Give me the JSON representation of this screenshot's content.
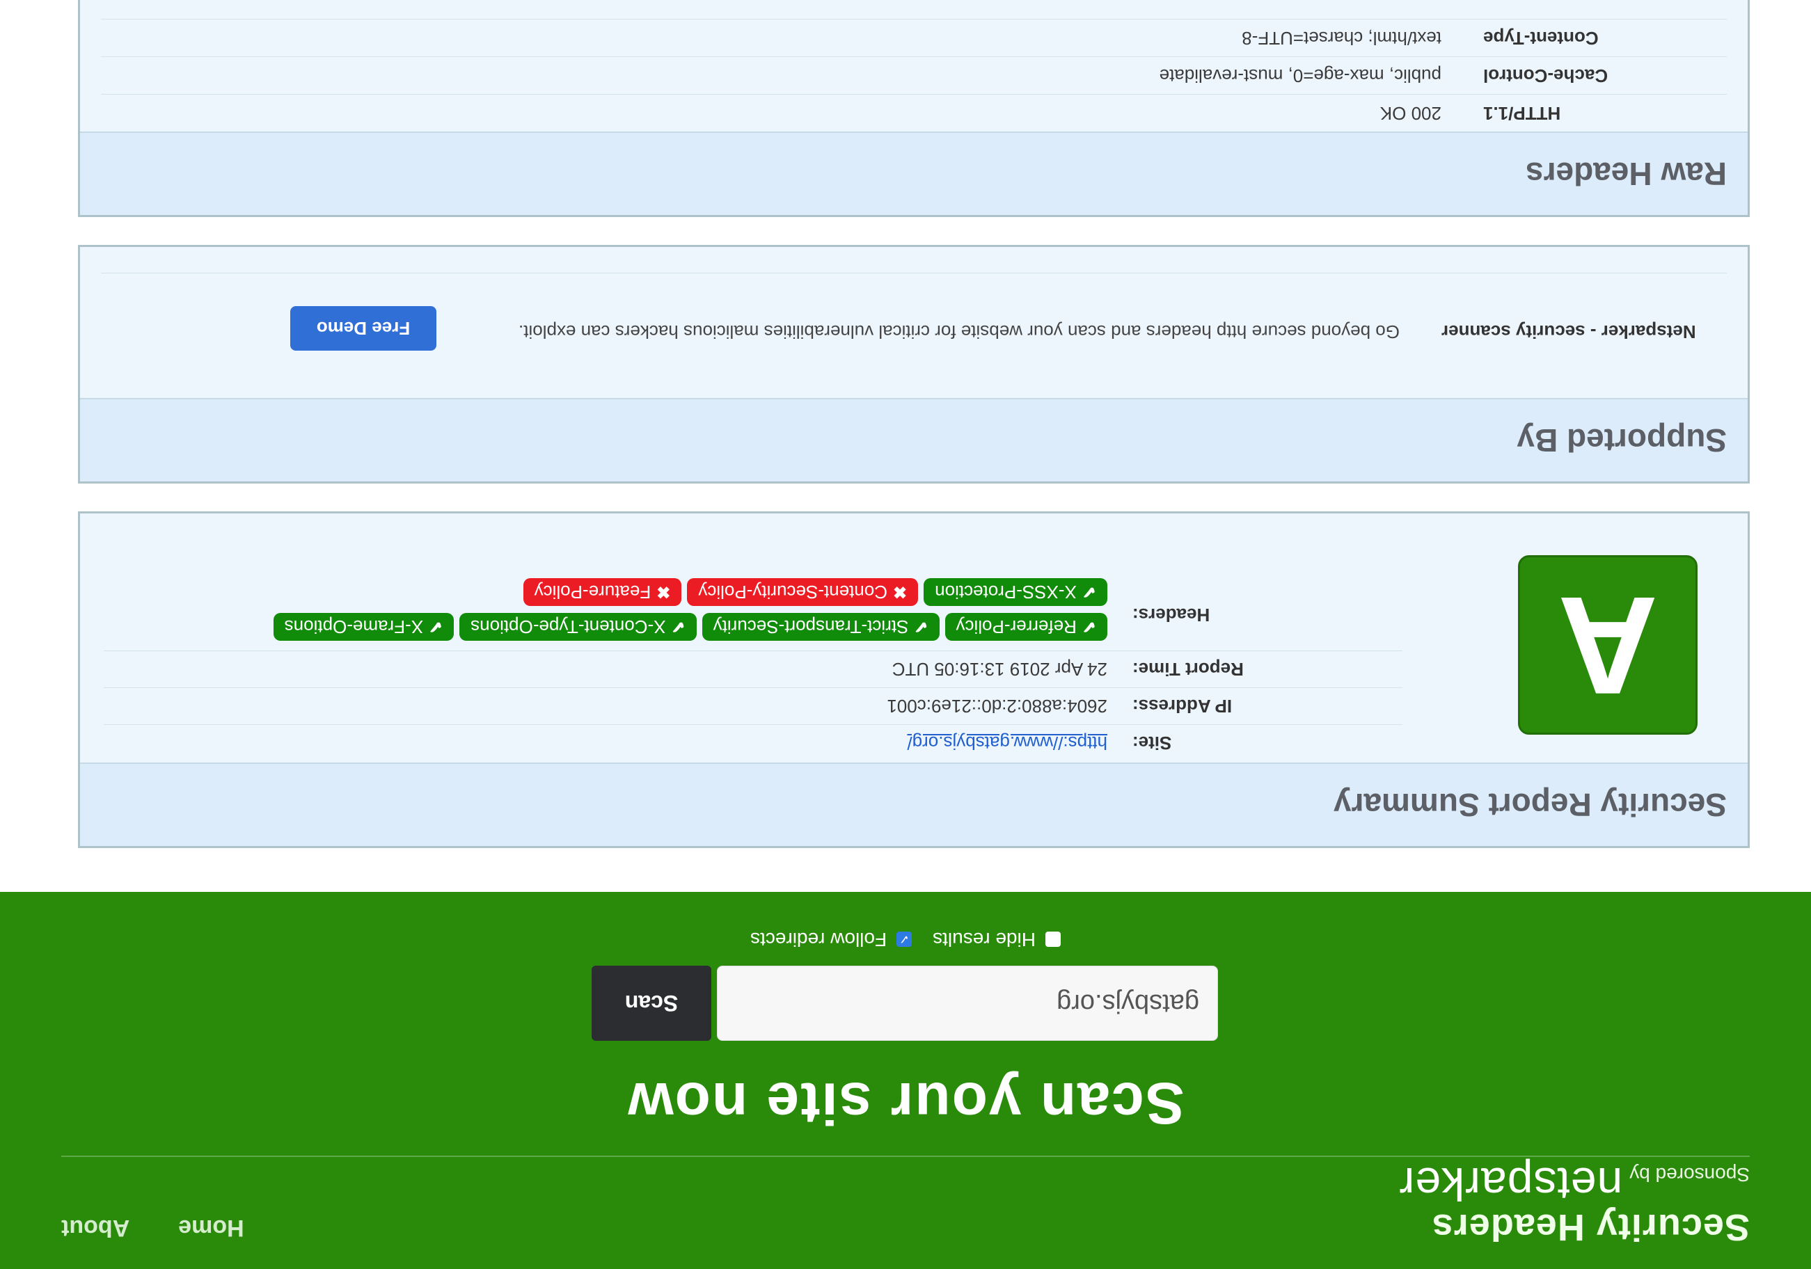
{
  "header": {
    "brand_title": "Security Headers",
    "brand_sponsored": "Sponsored by",
    "brand_logo": "netsparker",
    "nav": [
      {
        "label": "Home"
      },
      {
        "label": "About"
      }
    ],
    "hero_title": "Scan your site now",
    "scan_input_value": "gatsbyjs.org",
    "scan_button_label": "Scan",
    "options": {
      "hide_results_label": "Hide results",
      "hide_results_checked": false,
      "follow_redirects_label": "Follow redirects",
      "follow_redirects_checked": true
    },
    "colors": {
      "header_bg": "#2a8b0a",
      "grade_bg": "#2a8b0a"
    }
  },
  "summary": {
    "title": "Security Report Summary",
    "grade": "A",
    "rows": [
      {
        "label": "Site:",
        "value": "https://www.gatsbyjs.org/"
      },
      {
        "label": "IP Address:",
        "value": "2604:a880:2:d0::21e9:c001"
      },
      {
        "label": "Report Time:",
        "value": "24 Apr 2019 13:16:05 UTC"
      }
    ],
    "headers_label": "Headers:",
    "badges": [
      {
        "name": "Referrer-Policy",
        "status": "ok"
      },
      {
        "name": "Strict-Transport-Security",
        "status": "ok"
      },
      {
        "name": "X-Content-Type-Options",
        "status": "ok"
      },
      {
        "name": "X-Frame-Options",
        "status": "ok"
      },
      {
        "name": "X-XSS-Protection",
        "status": "ok"
      },
      {
        "name": "Content-Security-Policy",
        "status": "bad"
      },
      {
        "name": "Feature-Policy",
        "status": "bad"
      }
    ]
  },
  "supported": {
    "title": "Supported By",
    "label": "Netsparker - security scanner",
    "text": "Go beyond secure http headers and scan your website for critical vulnerabilities malicious hackers can exploit.",
    "button_label": "Free Demo"
  },
  "raw": {
    "title": "Raw Headers",
    "rows": [
      {
        "label": "HTTP/1.1",
        "value": "200 OK"
      },
      {
        "label": "Cache-Control",
        "value": "public, max-age=0, must-revalidate"
      },
      {
        "label": "Content-Type",
        "value": "text/html; charset=UTF-8"
      }
    ]
  }
}
